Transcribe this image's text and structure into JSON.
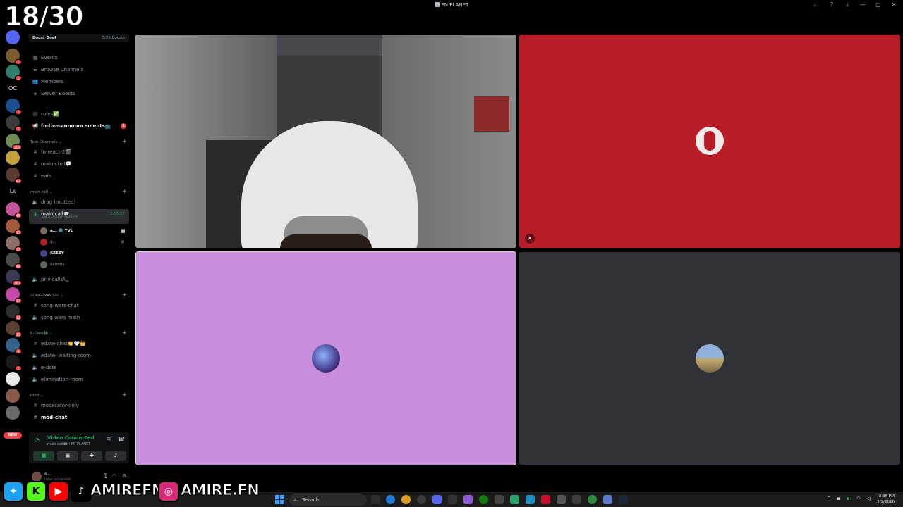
{
  "stream_overlay": {
    "counter": "18/30",
    "handle_primary": "AMIREFN",
    "handle_instagram": "AMIRE.FN"
  },
  "window": {
    "title": "FN PLANET"
  },
  "server": {
    "boost_goal_label": "Boost Goal",
    "boost_count": "0/28 Boosts",
    "nav": [
      "Events",
      "Browse Channels",
      "Members",
      "Server Boosts"
    ],
    "rules": "rules✅",
    "announcements": "fn-live-announcements📺",
    "announcements_unread": "1"
  },
  "categories": {
    "text": "Text Channels",
    "main_call": "main call",
    "song_wars": "SONG-WARS🎶",
    "edate": "E-Date👬",
    "mod": "mod"
  },
  "channels": {
    "fn_react": "fn-react-2🎬",
    "main_chat": "main-chat💬",
    "eats": "eats",
    "drag": "drag (mutted)",
    "main_call": "main call☎",
    "main_call_timer": "3:55:57",
    "main_call_status": "Set a channel status ✏",
    "priv_calls": "priv calls📞",
    "song_wars_chat": "song-wars-chat",
    "song_wars_main": "song wars main",
    "edate_chat": "edate-chat👏🤍👑",
    "edate_waiting": "edate- waiting-room",
    "edate": "e-date",
    "elimination": "elimination-room",
    "moderator_only": "moderator-only",
    "mod_chat": "mod-chat"
  },
  "voice_users": [
    {
      "name": "a... 🌚 YVL"
    },
    {
      "name": "g..."
    },
    {
      "name": "KEEZY"
    },
    {
      "name": "yammy"
    }
  ],
  "voice_connection": {
    "status": "Video Connected",
    "channel": "main call☎ / FN PLANET"
  },
  "user_panel": {
    "name": "a...",
    "sub": "tiktok.com/amirefn"
  },
  "taskbar": {
    "search_placeholder": "Search",
    "time": "8:36 PM",
    "date": "5/2/2026"
  },
  "colors": {
    "tile_red": "#b71c27",
    "tile_purple": "#c98edb",
    "tile_grey": "#313338",
    "connected_green": "#23a55a",
    "unread_red": "#f23f43"
  },
  "guild_badges": [
    "1",
    "1",
    "1",
    "1",
    "109",
    "46",
    "63",
    "46",
    "13",
    "13",
    "46",
    "161",
    "37",
    "12",
    "15",
    "4",
    "1"
  ]
}
